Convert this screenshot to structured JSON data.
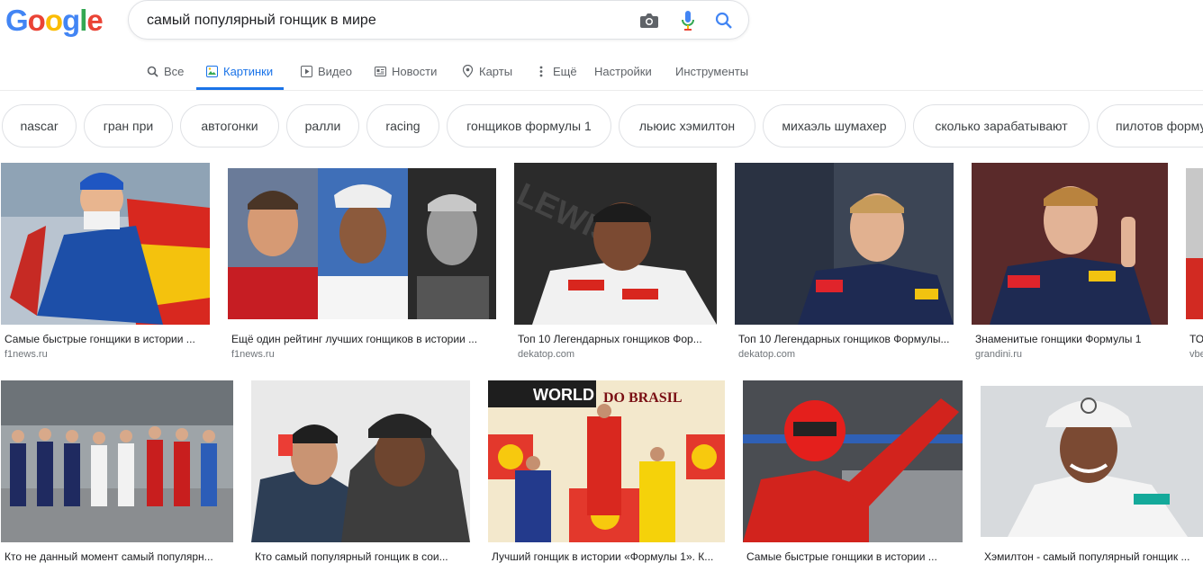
{
  "logo": {
    "letters": [
      "G",
      "o",
      "o",
      "g",
      "l",
      "e"
    ],
    "colors": [
      "#4285F4",
      "#EA4335",
      "#FBBC05",
      "#4285F4",
      "#34A853",
      "#EA4335"
    ]
  },
  "search": {
    "query": "самый популярный гонщик в мире"
  },
  "tabs": [
    {
      "label": "Все",
      "icon": "search-icon"
    },
    {
      "label": "Картинки",
      "icon": "image-icon",
      "active": true
    },
    {
      "label": "Видео",
      "icon": "play-icon"
    },
    {
      "label": "Новости",
      "icon": "news-icon"
    },
    {
      "label": "Карты",
      "icon": "map-pin-icon"
    },
    {
      "label": "Ещё",
      "icon": "more-vert-icon"
    },
    {
      "label": "Настройки"
    },
    {
      "label": "Инструменты"
    }
  ],
  "chips": [
    "nascar",
    "гран при",
    "автогонки",
    "ралли",
    "racing",
    "гонщиков формулы 1",
    "льюис хэмилтон",
    "михаэль шумахер",
    "сколько зарабатывают",
    "пилотов формулы"
  ],
  "results": {
    "row1": [
      {
        "caption": "Самые быстрые гонщики в истории ...",
        "source": "f1news.ru"
      },
      {
        "caption": "Ещё один рейтинг лучших гонщиков в истории ...",
        "source": "f1news.ru"
      },
      {
        "caption": "Топ 10 Легендарных гонщиков Фор...",
        "source": "dekatop.com"
      },
      {
        "caption": "Топ 10 Легендарных гонщиков Формулы...",
        "source": "dekatop.com"
      },
      {
        "caption": "Знаменитые гонщики Формулы 1",
        "source": "grandini.ru"
      },
      {
        "caption": "ТОП",
        "source": "vbe"
      }
    ],
    "row2": [
      {
        "caption": "Кто не данный момент самый популярн..."
      },
      {
        "caption": "Кто самый популярный гонщик в сои..."
      },
      {
        "caption": "Лучший гонщик в истории «Формулы 1». К..."
      },
      {
        "caption": "Самые быстрые гонщики в истории ..."
      },
      {
        "caption": "Хэмилтон - самый популярный гонщик ..."
      }
    ]
  },
  "colors": {
    "accent": "#1a73e8",
    "text": "#202124",
    "muted": "#70757a"
  }
}
